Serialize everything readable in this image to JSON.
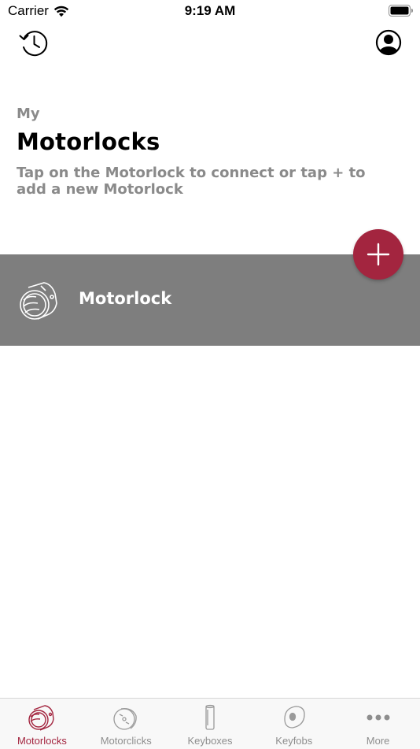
{
  "status_bar": {
    "carrier": "Carrier",
    "time": "9:19 AM"
  },
  "header": {
    "eyebrow": "My",
    "title": "Motorlocks",
    "subtitle": "Tap on the Motorlock to connect or tap + to add a new Motorlock"
  },
  "devices": [
    {
      "label": "Motorlock",
      "icon": "motorlock-icon"
    }
  ],
  "fab": {
    "icon": "plus-icon"
  },
  "tabs": [
    {
      "label": "Motorlocks",
      "icon": "motorlock-tab-icon",
      "active": true
    },
    {
      "label": "Motorclicks",
      "icon": "motorclick-tab-icon",
      "active": false
    },
    {
      "label": "Keyboxes",
      "icon": "keybox-tab-icon",
      "active": false
    },
    {
      "label": "Keyfobs",
      "icon": "keyfob-tab-icon",
      "active": false
    },
    {
      "label": "More",
      "icon": "more-icon",
      "active": false
    }
  ],
  "colors": {
    "accent": "#a3253f",
    "row_background": "#7e7e7e",
    "muted_text": "#8a8a8a",
    "inactive_tab": "#8e8e8e"
  }
}
